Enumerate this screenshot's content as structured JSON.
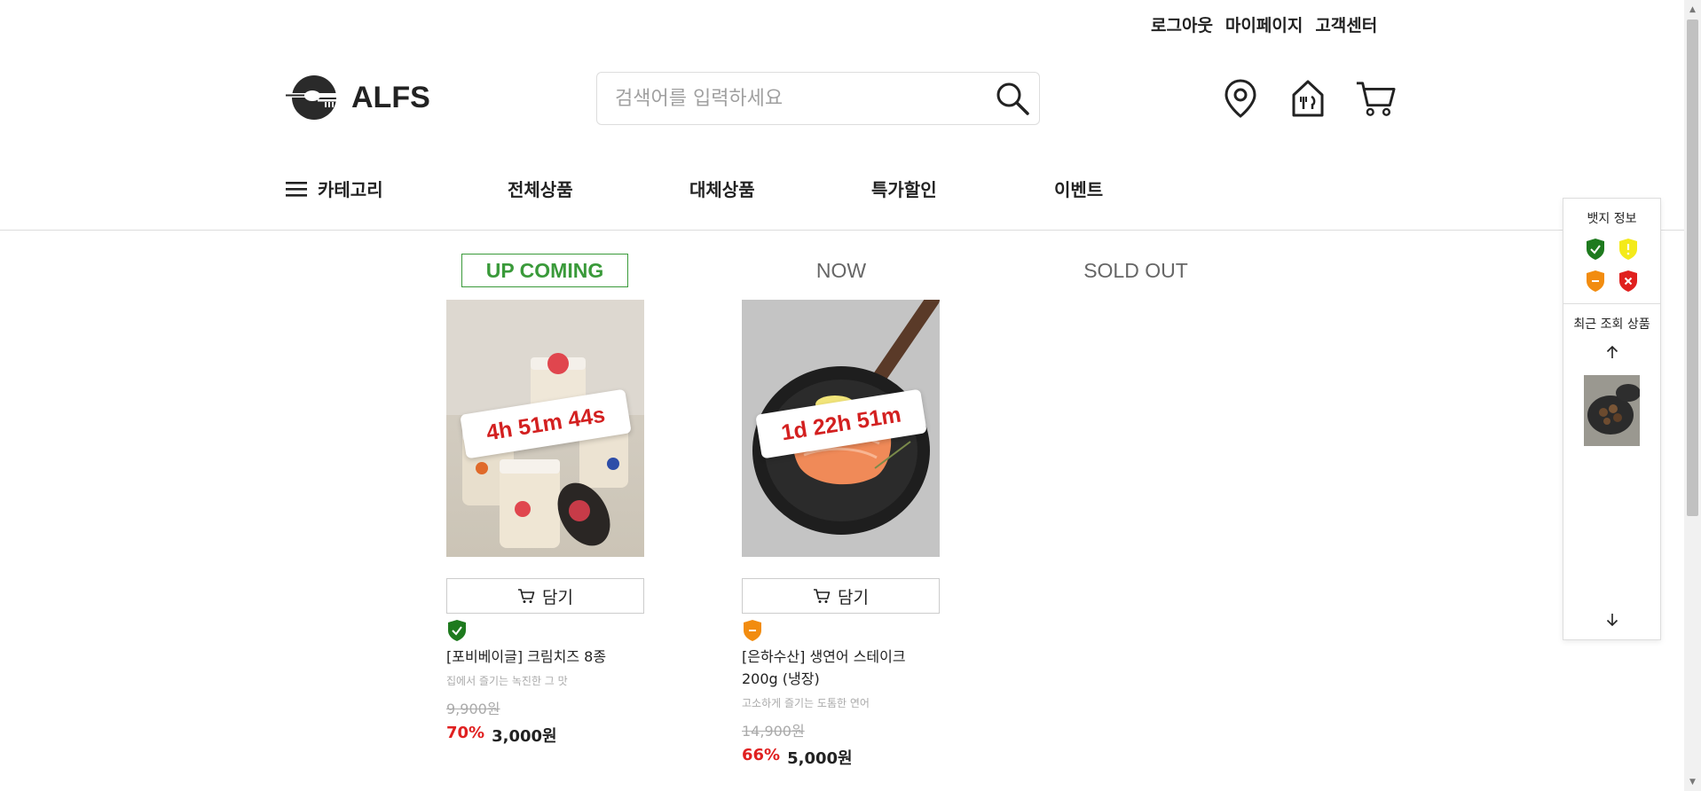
{
  "util_links": {
    "logout": "로그아웃",
    "mypage": "마이페이지",
    "support": "고객센터"
  },
  "logo": {
    "text": "ALFS"
  },
  "search": {
    "placeholder": "검색어를 입력하세요"
  },
  "header_icons": [
    "location-pin-icon",
    "store-icon",
    "cart-icon"
  ],
  "nav": {
    "category": "카테고리",
    "items": [
      "전체상품",
      "대체상품",
      "특가할인",
      "이벤트"
    ]
  },
  "tabs": [
    {
      "label": "UP COMING",
      "active": true
    },
    {
      "label": "NOW",
      "active": false
    },
    {
      "label": "SOLD OUT",
      "active": false
    }
  ],
  "products": [
    {
      "timer": "4h 51m 44s",
      "cart_label": "담기",
      "badge": "green-check",
      "name": "[포비베이글] 크림치즈 8종",
      "desc": "집에서 즐기는 녹진한 그 맛",
      "original_price": "9,900원",
      "discount": "70%",
      "price": "3,000원"
    },
    {
      "timer": "1d 22h 51m",
      "cart_label": "담기",
      "badge": "orange-minus",
      "name": "[은하수산] 생연어 스테이크 200g (냉장)",
      "desc": "고소하게 즐기는 도톰한 연어",
      "original_price": "14,900원",
      "discount": "66%",
      "price": "5,000원"
    }
  ],
  "side_panel": {
    "badge_title": "뱃지 정보",
    "recent_title": "최근 조회 상품"
  },
  "colors": {
    "accent_green": "#3a9a3a",
    "discount_red": "#e02020",
    "timer_red": "#d32020",
    "badge_green": "#1e7a1e",
    "badge_yellow": "#f4ea1a",
    "badge_orange": "#f28c0f",
    "badge_red": "#e0201e"
  }
}
